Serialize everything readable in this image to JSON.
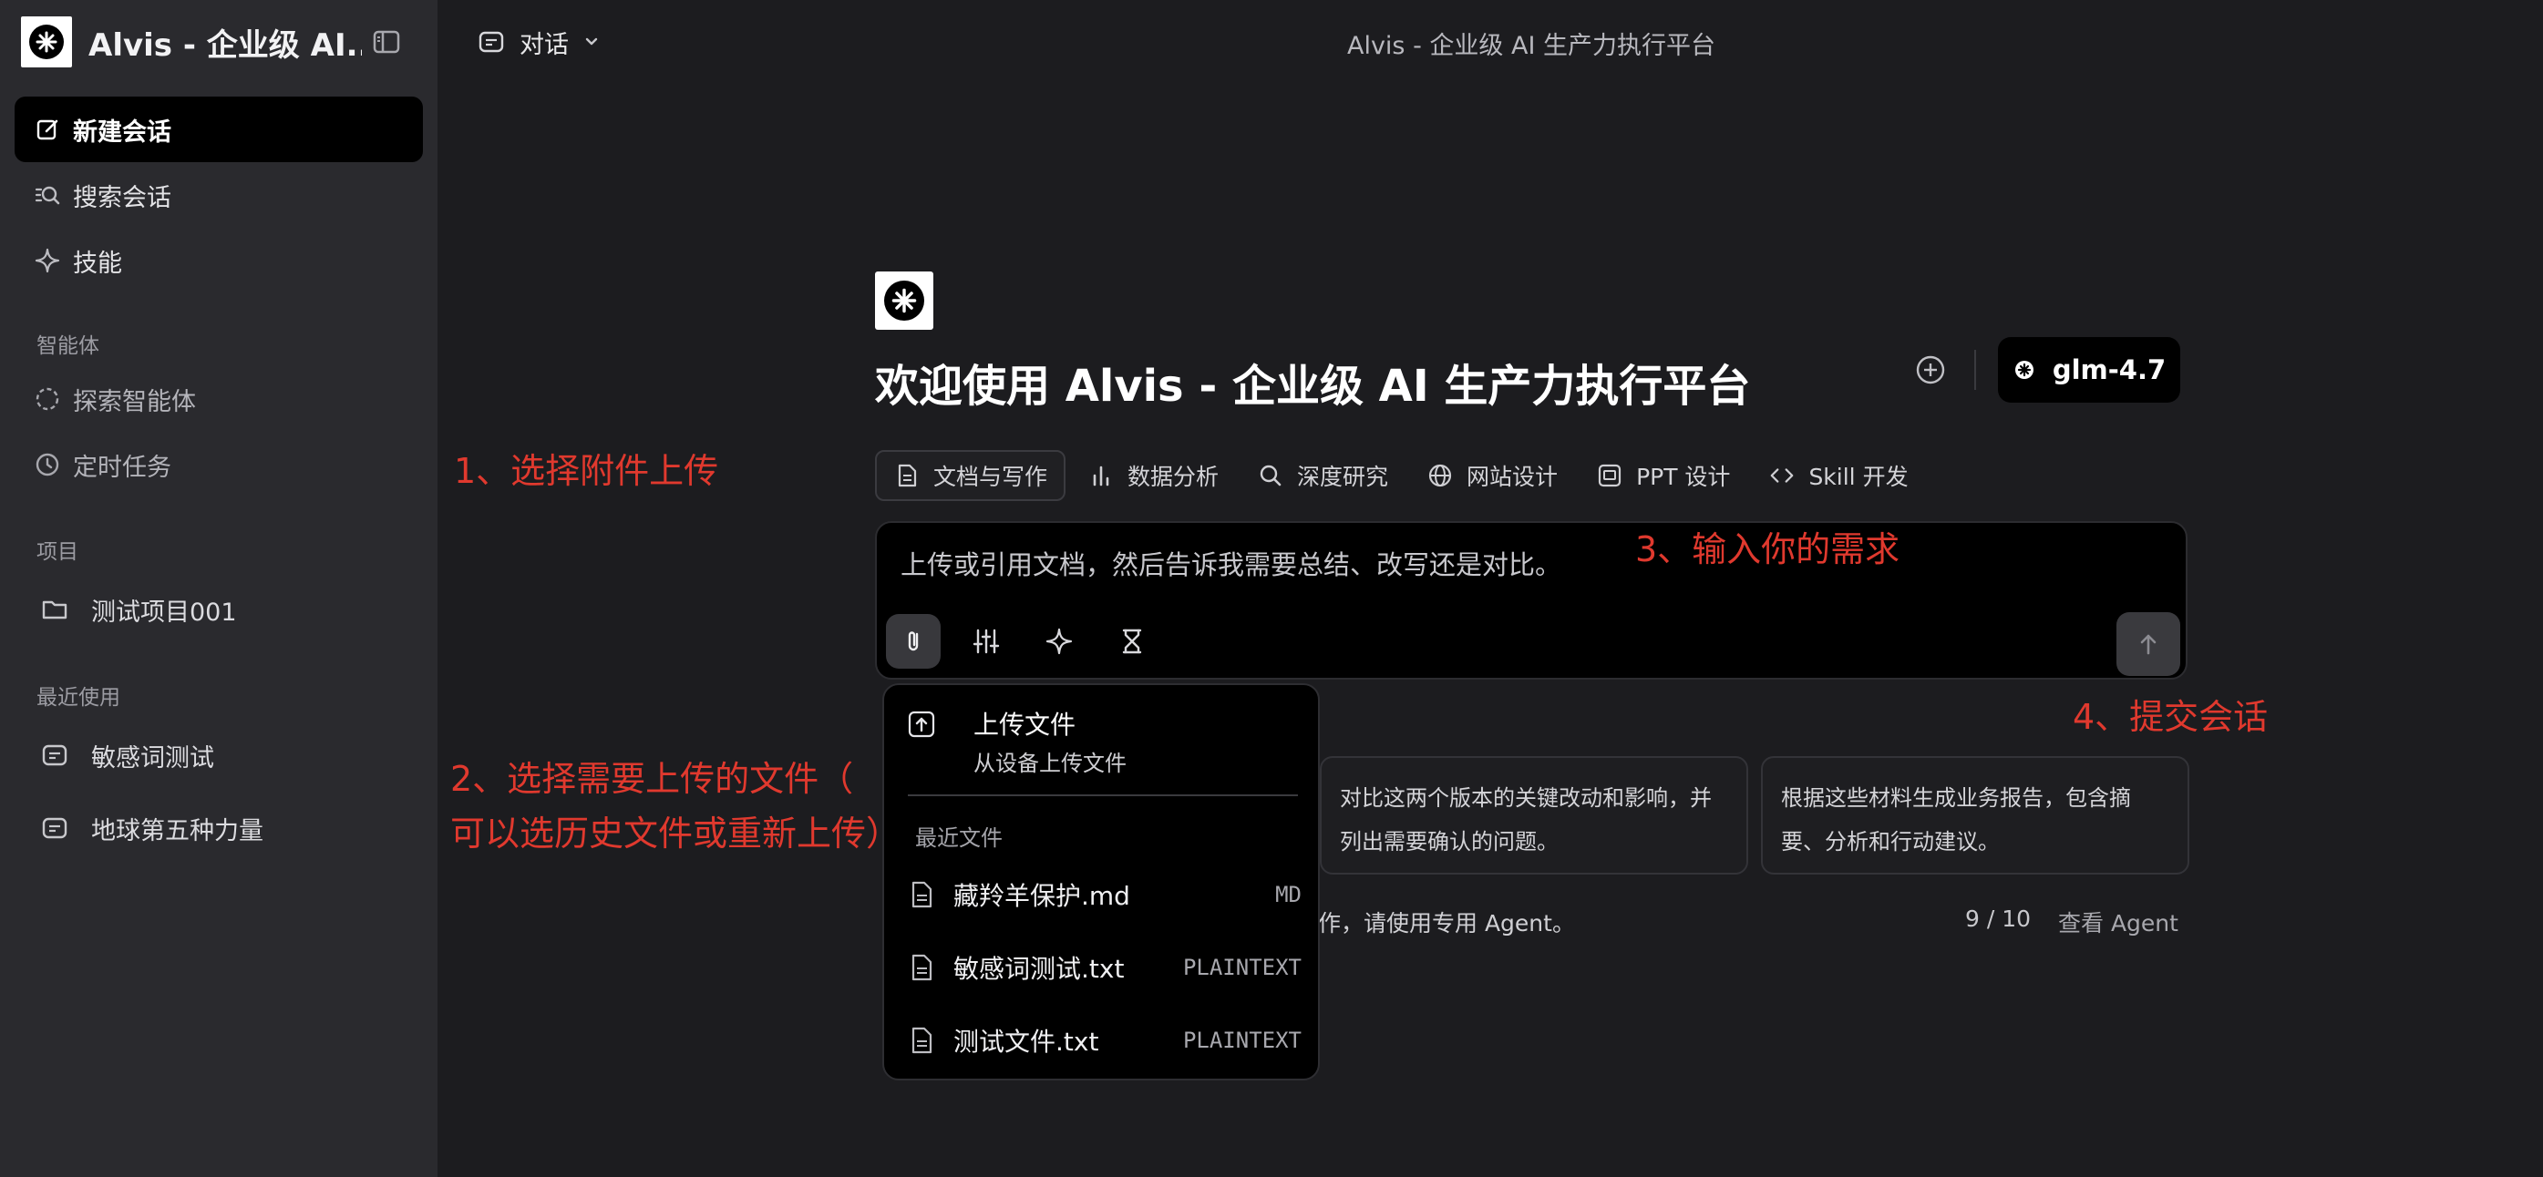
{
  "sidebar": {
    "app_title": "Alvis - 企业级 AI...",
    "new_chat": "新建会话",
    "search_chat": "搜索会话",
    "skills": "技能",
    "agents_section": "智能体",
    "explore_agents": "探索智能体",
    "scheduled_tasks": "定时任务",
    "projects_section": "项目",
    "projects": [
      {
        "label": "测试项目001"
      }
    ],
    "recent_section": "最近使用",
    "recent": [
      {
        "label": "敏感词测试"
      },
      {
        "label": "地球第五种力量"
      }
    ]
  },
  "topbar": {
    "mode_label": "对话",
    "page_title": "Alvis - 企业级 AI 生产力执行平台"
  },
  "main": {
    "welcome": "欢迎使用 Alvis - 企业级 AI 生产力执行平台",
    "model": "glm-4.7",
    "chips": [
      {
        "label": "文档与写作",
        "icon": "document-icon"
      },
      {
        "label": "数据分析",
        "icon": "bar-chart-icon"
      },
      {
        "label": "深度研究",
        "icon": "search-icon"
      },
      {
        "label": "网站设计",
        "icon": "globe-icon"
      },
      {
        "label": "PPT 设计",
        "icon": "slides-icon"
      },
      {
        "label": "Skill 开发",
        "icon": "code-icon"
      }
    ],
    "input_placeholder": "上传或引用文档，然后告诉我需要总结、改写还是对比。",
    "suggestions": [
      {
        "text": "对比这两个版本的关键改动和影响，并列出需要确认的问题。"
      },
      {
        "text": "根据这些材料生成业务报告，包含摘要、分析和行动建议。"
      }
    ],
    "footer_note": "作，请使用专用 Agent。",
    "counter": "9 / 10",
    "view_agent": "查看 Agent"
  },
  "dropdown": {
    "upload_title": "上传文件",
    "upload_subtitle": "从设备上传文件",
    "recent_label": "最近文件",
    "files": [
      {
        "name": "藏羚羊保护.md",
        "type": "MD"
      },
      {
        "name": "敏感词测试.txt",
        "type": "PLAINTEXT"
      },
      {
        "name": "测试文件.txt",
        "type": "PLAINTEXT"
      }
    ]
  },
  "annotations": {
    "step1": "1、选择附件上传",
    "step2_line1": "2、选择需要上传的文件（",
    "step2_line2": "可以选历史文件或重新上传）",
    "step3": "3、输入你的需求",
    "step4": "4、提交会话"
  },
  "colors": {
    "background": "#1c1c1f",
    "sidebar": "#2a2a2e",
    "annotation": "#e0392e",
    "accent_active": "#000000"
  }
}
